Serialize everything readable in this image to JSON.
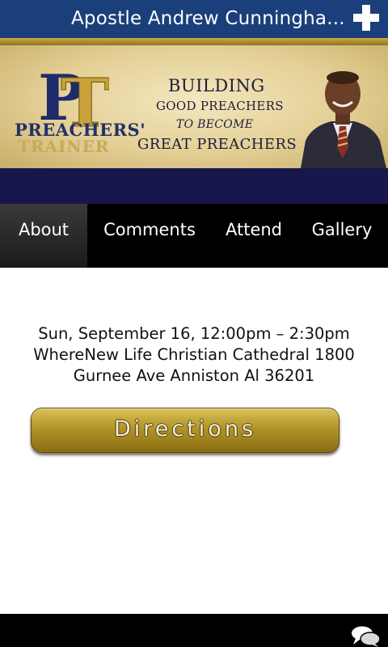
{
  "header": {
    "title": "Apostle Andrew Cunningha...",
    "add_icon": "plus-icon"
  },
  "banner": {
    "logo_letters": "PT",
    "logo_name": "PREACHERS'",
    "logo_sub": "TRAINER",
    "tagline": [
      "BUILDING",
      "GOOD PREACHERS",
      "TO BECOME",
      "GREAT PREACHERS"
    ]
  },
  "tabs": [
    {
      "label": "About",
      "active": true
    },
    {
      "label": "Comments",
      "active": false
    },
    {
      "label": "Attend",
      "active": false
    },
    {
      "label": "Gallery",
      "active": false
    }
  ],
  "event": {
    "when": "Sun, September 16, 12:00pm – 2:30pm",
    "where_line1": "WhereNew Life Christian Cathedral 1800",
    "where_line2": "Gurnee Ave Anniston Al 36201"
  },
  "directions_label": "Directions",
  "footer": {
    "comments_icon": "chat-bubbles-icon"
  },
  "colors": {
    "header_blue": "#1b3f7a",
    "gold": "#b39428",
    "navy": "#17174c"
  }
}
